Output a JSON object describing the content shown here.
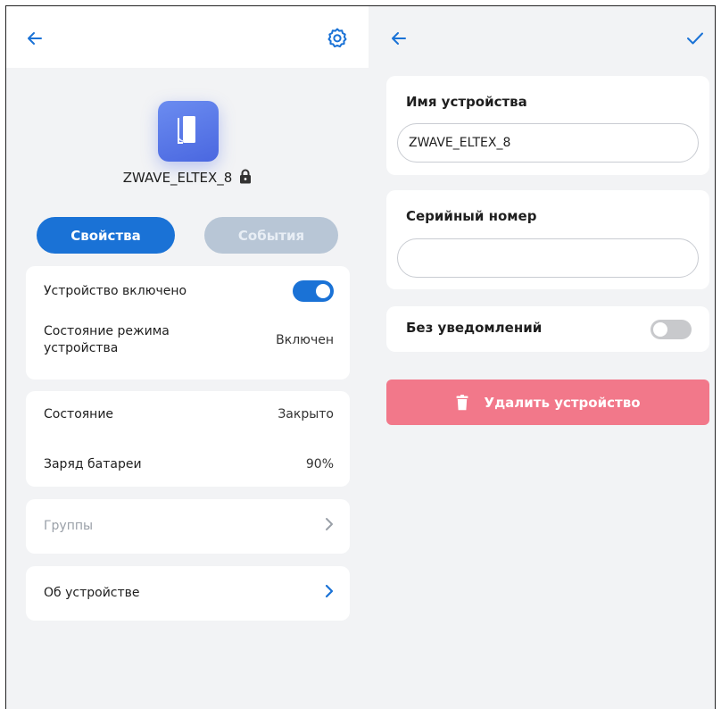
{
  "left": {
    "device_name": "ZWAVE_ELTEX_8",
    "tabs": [
      {
        "label": "Свойства",
        "active": true
      },
      {
        "label": "События",
        "active": false
      }
    ],
    "power_card": {
      "enabled_label": "Устройство включено",
      "enabled": true,
      "mode_label": "Состояние режима\nустройства",
      "mode_value": "Включен"
    },
    "status_card": {
      "state_label": "Состояние",
      "state_value": "Закрыто",
      "battery_label": "Заряд батареи",
      "battery_value": "90%"
    },
    "groups_label": "Группы",
    "about_label": "Об устройстве"
  },
  "right": {
    "name_label": "Имя устройства",
    "name_value": "ZWAVE_ELTEX_8",
    "serial_label": "Серийный номер",
    "serial_value": "",
    "silent_label": "Без уведомлений",
    "silent": false,
    "delete_label": "Удалить устройство"
  },
  "icons": [
    "back-arrow-icon",
    "gear-icon",
    "door-icon",
    "lock-icon",
    "chevron-right-icon",
    "checkmark-icon",
    "trash-icon"
  ],
  "colors": {
    "accent": "#1a72d6",
    "tab_inactive": "#b8c6d6",
    "danger": "#f2788a",
    "background": "#f2f3f5"
  }
}
